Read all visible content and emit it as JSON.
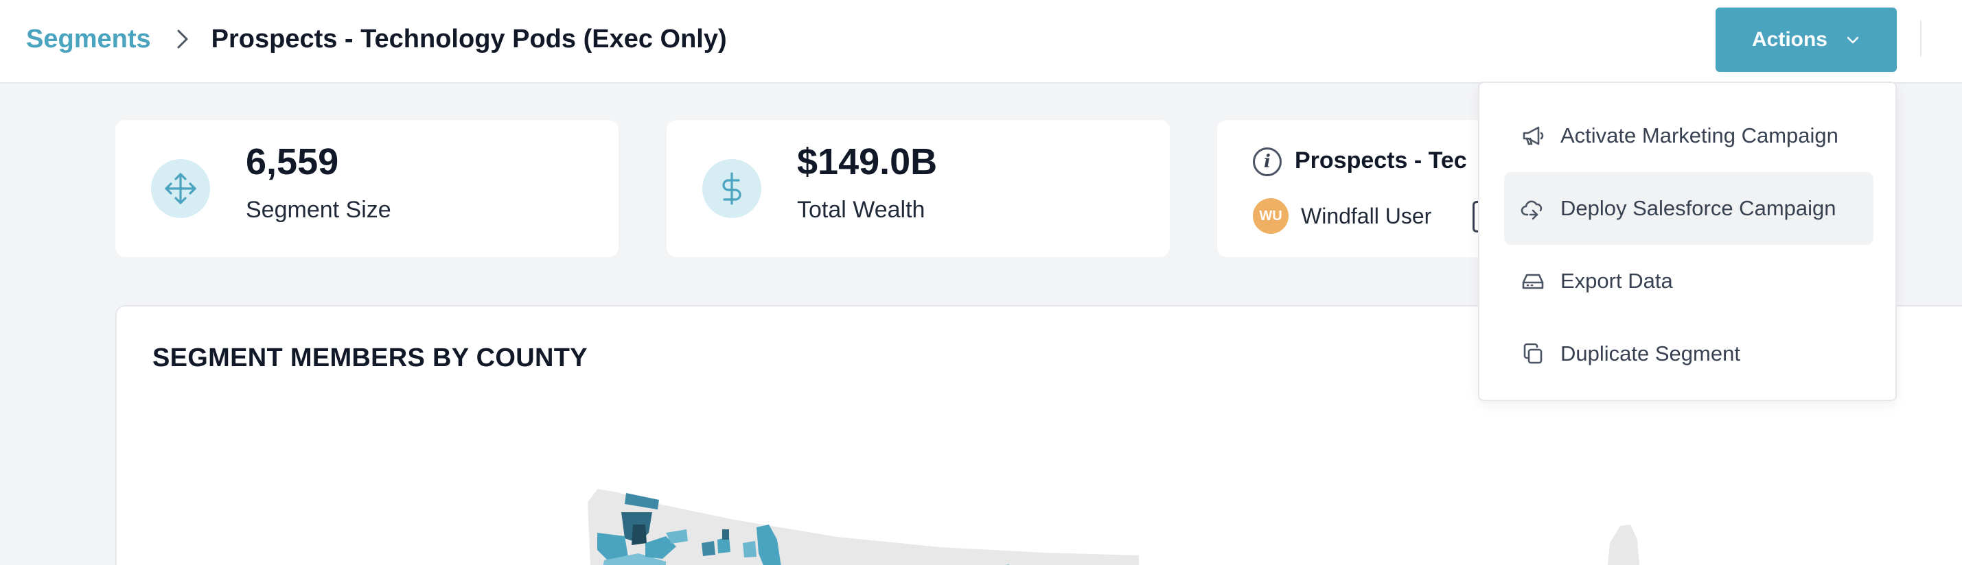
{
  "breadcrumb": {
    "root": "Segments",
    "current": "Prospects - Technology Pods (Exec Only)"
  },
  "header": {
    "actions_label": "Actions"
  },
  "stats": [
    {
      "value": "6,559",
      "label": "Segment Size",
      "icon": "move-arrows-icon"
    },
    {
      "value": "$149.0B",
      "label": "Total Wealth",
      "icon": "dollar-icon"
    }
  ],
  "info_card": {
    "title": "Prospects - Tec",
    "avatar_initials": "WU",
    "owner": "Windfall User"
  },
  "map": {
    "title": "SEGMENT MEMBERS BY COUNTY"
  },
  "dropdown": {
    "items": [
      {
        "label": "Activate Marketing Campaign",
        "icon": "megaphone-icon"
      },
      {
        "label": "Deploy Salesforce Campaign",
        "icon": "cloud-icon",
        "hovered": true
      },
      {
        "label": "Export Data",
        "icon": "hard-drive-icon"
      },
      {
        "label": "Duplicate Segment",
        "icon": "copy-icon"
      }
    ]
  },
  "colors": {
    "accent": "#4aa3bf",
    "icon_bg": "#d6edf4",
    "avatar": "#f0b063",
    "page_bg": "#f3f4f6"
  }
}
